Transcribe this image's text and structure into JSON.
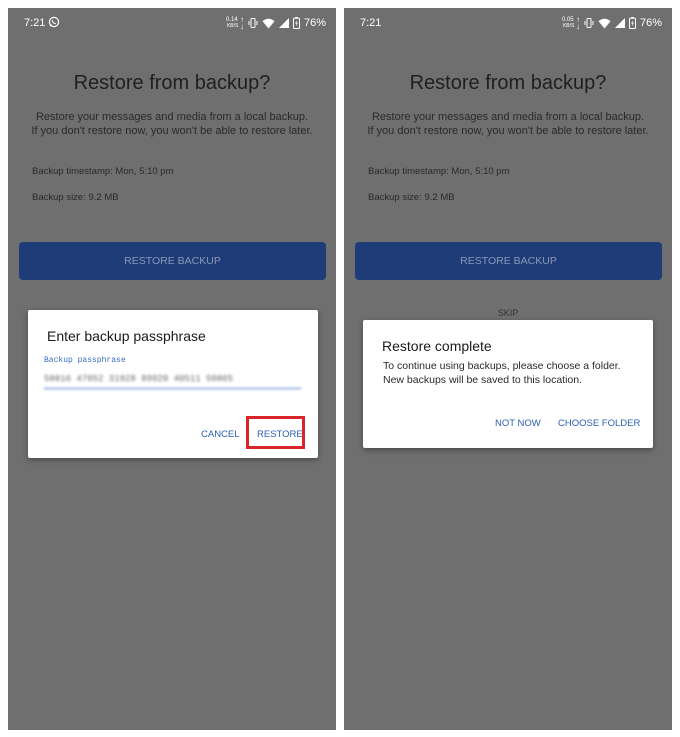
{
  "left_screen": {
    "status": {
      "time": "7:21",
      "speed_value": "0.14",
      "speed_unit": "KB/S",
      "battery": "76%"
    },
    "title": "Restore from backup?",
    "description_line1": "Restore your messages and media from a local backup.",
    "description_line2": "If you don't restore now, you won't be able to restore later.",
    "backup_timestamp": "Backup timestamp: Mon, 5:10 pm",
    "backup_size": "Backup size: 9.2 MB",
    "restore_backup_label": "RESTORE BACKUP",
    "dialog": {
      "title": "Enter backup passphrase",
      "field_label": "Backup passphrase",
      "field_value": "58816 47052 31928 89920 40511 50865",
      "cancel_label": "CANCEL",
      "restore_label": "RESTORE"
    }
  },
  "right_screen": {
    "status": {
      "time": "7:21",
      "speed_value": "0.05",
      "speed_unit": "KB/S",
      "battery": "76%"
    },
    "title": "Restore from backup?",
    "description_line1": "Restore your messages and media from a local backup.",
    "description_line2": "If you don't restore now, you won't be able to restore later.",
    "backup_timestamp": "Backup timestamp: Mon, 5:10 pm",
    "backup_size": "Backup size: 9.2 MB",
    "restore_backup_label": "RESTORE BACKUP",
    "skip_label": "SKIP",
    "dialog": {
      "title": "Restore complete",
      "body_line1": "To continue using backups, please choose a folder.",
      "body_line2": "New backups will be saved to this location.",
      "not_now_label": "NOT NOW",
      "choose_folder_label": "CHOOSE FOLDER"
    }
  },
  "colors": {
    "scrim": "#6f6f6f",
    "button_primary": "#1e3c78",
    "accent": "#2d5fb3",
    "highlight": "#d9252a"
  },
  "icons": [
    "whatsapp-icon",
    "data-arrows-icon",
    "vibrate-icon",
    "wifi-icon",
    "signal-icon",
    "battery-icon"
  ]
}
